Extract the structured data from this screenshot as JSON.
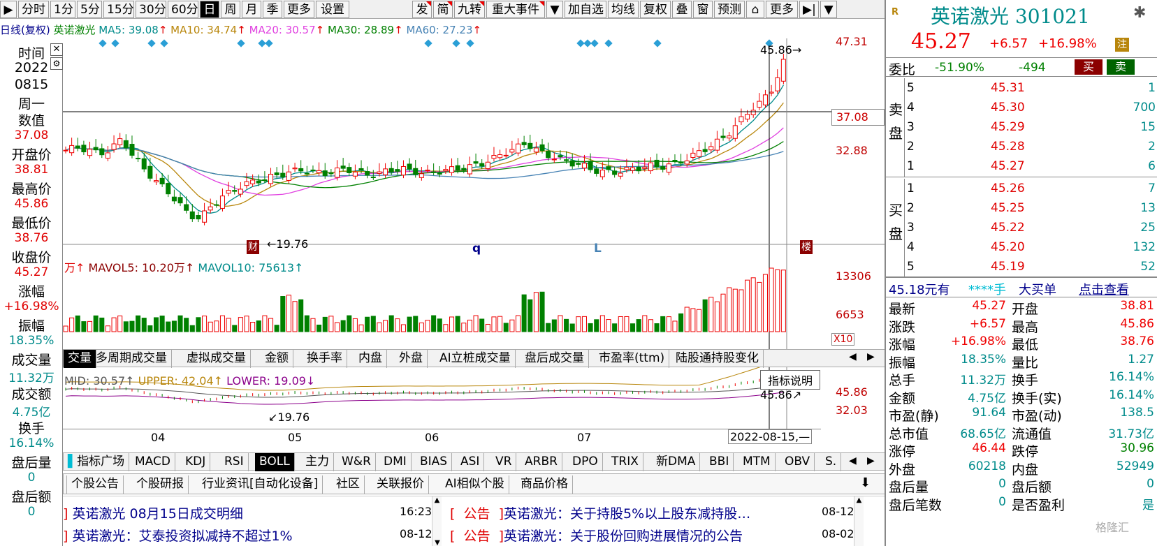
{
  "toolbar": {
    "items": [
      "分时",
      "1分",
      "5分",
      "15分",
      "30分",
      "60分",
      "日",
      "周",
      "月",
      "季",
      "更多",
      "设置"
    ],
    "right_items": [
      "发",
      "简",
      "九转",
      "重大事件",
      "加自选",
      "均线",
      "复权",
      "叠",
      "窗",
      "预测",
      "更多"
    ]
  },
  "ma_line": {
    "label": "日线(复权)",
    "name": "英诺激光",
    "ma5": "MA5: 39.08",
    "ma10": "MA10: 34.74",
    "ma20": "MA20: 30.57",
    "ma30": "MA30: 28.89",
    "ma60": "MA60: 27.23",
    "up": "↑"
  },
  "left_info": {
    "time_label": "时间",
    "year": "2022",
    "date": "0815",
    "weekday": "周一",
    "value_label": "数值",
    "value": "37.08",
    "open_label": "开盘价",
    "open": "38.81",
    "high_label": "最高价",
    "high": "45.86",
    "low_label": "最低价",
    "low": "38.76",
    "close_label": "收盘价",
    "close": "45.27",
    "chg_label": "涨幅",
    "chg": "+16.98%",
    "amp_label": "振幅",
    "amp": "18.35%",
    "vol_label": "成交量",
    "vol": "11.32万",
    "amt_label": "成交额",
    "amt": "4.75亿",
    "turn_label": "换手",
    "turn": "16.14%",
    "after_vol_label": "盘后量",
    "after_vol": "0",
    "after_amt_label": "盘后额",
    "after_amt": "0"
  },
  "price_axis": {
    "top": "47.31",
    "cross": "37.08",
    "mid": "32.88"
  },
  "price_annotations": {
    "high": "45.86",
    "low": "19.76",
    "flag_cai": "财",
    "flag_lou": "楼",
    "mark_q": "q",
    "mark_l": "L"
  },
  "vol_line": {
    "prefix": "万↑",
    "mavol5": "MAVOL5: 10.20万↑",
    "mavol10": "MAVOL10: 75613↑"
  },
  "vol_axis": {
    "top": "13306",
    "mid": "6653",
    "mult": "X10"
  },
  "vol_tabs": [
    "交量",
    "多周期成交量",
    "虚拟成交量",
    "金额",
    "换手率",
    "内盘",
    "外盘",
    "AI立桩成交量",
    "盘后成交量",
    "市盈率(ttm)",
    "陆股通持股变化"
  ],
  "boll_line": {
    "mid": "MID: 30.57↑",
    "upper": "UPPER: 42.04↑",
    "lower": "LOWER: 19.09↓",
    "help": "指标说明"
  },
  "boll_axis": {
    "top": "45.86",
    "mid": "32.03",
    "high": "45.86",
    "low": "19.76"
  },
  "date_axis": [
    "04",
    "05",
    "06",
    "07"
  ],
  "date_cursor": "2022-08-15,—",
  "indicator_tabs": [
    "指标广场",
    "MACD",
    "KDJ",
    "RSI",
    "BOLL",
    "主力",
    "W&R",
    "DMI",
    "BIAS",
    "ASI",
    "VR",
    "ARBR",
    "DPO",
    "TRIX",
    "新DMA",
    "BBI",
    "MTM",
    "OBV",
    "S."
  ],
  "news_tabs": [
    "个股公告",
    "个股研报",
    "行业资讯[自动化设备]",
    "社区",
    "关联报价",
    "AI相似个股",
    "商品价格"
  ],
  "news_left": [
    {
      "text": "英诺激光 08月15日成交明细",
      "time": "16:23"
    },
    {
      "text": "英诺激光：艾泰投资拟减持不超过1%",
      "time": "08-12"
    }
  ],
  "news_right": [
    {
      "tag": "公告",
      "text": "英诺激光：关于持股5%以上股东减持股…",
      "time": "08-12"
    },
    {
      "tag": "公告",
      "text": "英诺激光：关于股份回购进展情况的公告",
      "time": "08-02"
    }
  ],
  "quote": {
    "name": "英诺激光",
    "code": "301021",
    "price": "45.27",
    "chg": "+6.57",
    "pct": "+16.98%",
    "zhu": "注",
    "wb_label": "委比",
    "wb": "-51.90%",
    "wc": "-494",
    "buy_btn": "买",
    "sell_btn": "卖",
    "sell_label": "卖盘",
    "buy_label": "买盘",
    "asks": [
      {
        "lv": "5",
        "p": "45.31",
        "v": "1"
      },
      {
        "lv": "4",
        "p": "45.30",
        "v": "700"
      },
      {
        "lv": "3",
        "p": "45.29",
        "v": "15"
      },
      {
        "lv": "2",
        "p": "45.28",
        "v": "2"
      },
      {
        "lv": "1",
        "p": "45.27",
        "v": "6"
      }
    ],
    "bids": [
      {
        "lv": "1",
        "p": "45.26",
        "v": "7"
      },
      {
        "lv": "2",
        "p": "45.25",
        "v": "13"
      },
      {
        "lv": "3",
        "p": "45.22",
        "v": "25"
      },
      {
        "lv": "4",
        "p": "45.20",
        "v": "132"
      },
      {
        "lv": "5",
        "p": "45.19",
        "v": "52"
      }
    ],
    "big_order": {
      "price": "45.18元有",
      "stars": "****手",
      "label": "大买单",
      "link": "点击查看"
    },
    "stats": [
      [
        "最新",
        "45.27",
        "开盘",
        "38.81"
      ],
      [
        "涨跌",
        "+6.57",
        "最高",
        "45.86"
      ],
      [
        "涨幅",
        "+16.98%",
        "最低",
        "38.76"
      ],
      [
        "振幅",
        "18.35%",
        "量比",
        "1.27"
      ],
      [
        "总手",
        "11.32万",
        "换手",
        "16.14%"
      ],
      [
        "金额",
        "4.75亿",
        "换手(实)",
        "16.14%"
      ],
      [
        "市盈(静)",
        "91.64",
        "市盈(动)",
        "138.5"
      ],
      [
        "总市值",
        "68.65亿",
        "流通值",
        "31.73亿"
      ],
      [
        "涨停",
        "46.44",
        "跌停",
        "30.96"
      ],
      [
        "外盘",
        "60218",
        "内盘",
        "52949"
      ],
      [
        "盘后量",
        "0",
        "盘后额",
        "0"
      ],
      [
        "盘后笔数",
        "0",
        "是否盈利",
        "是"
      ]
    ],
    "watermark": "格隆汇"
  },
  "colors": {
    "up": "#e00000",
    "down": "#008000",
    "axis": "#c00000"
  }
}
